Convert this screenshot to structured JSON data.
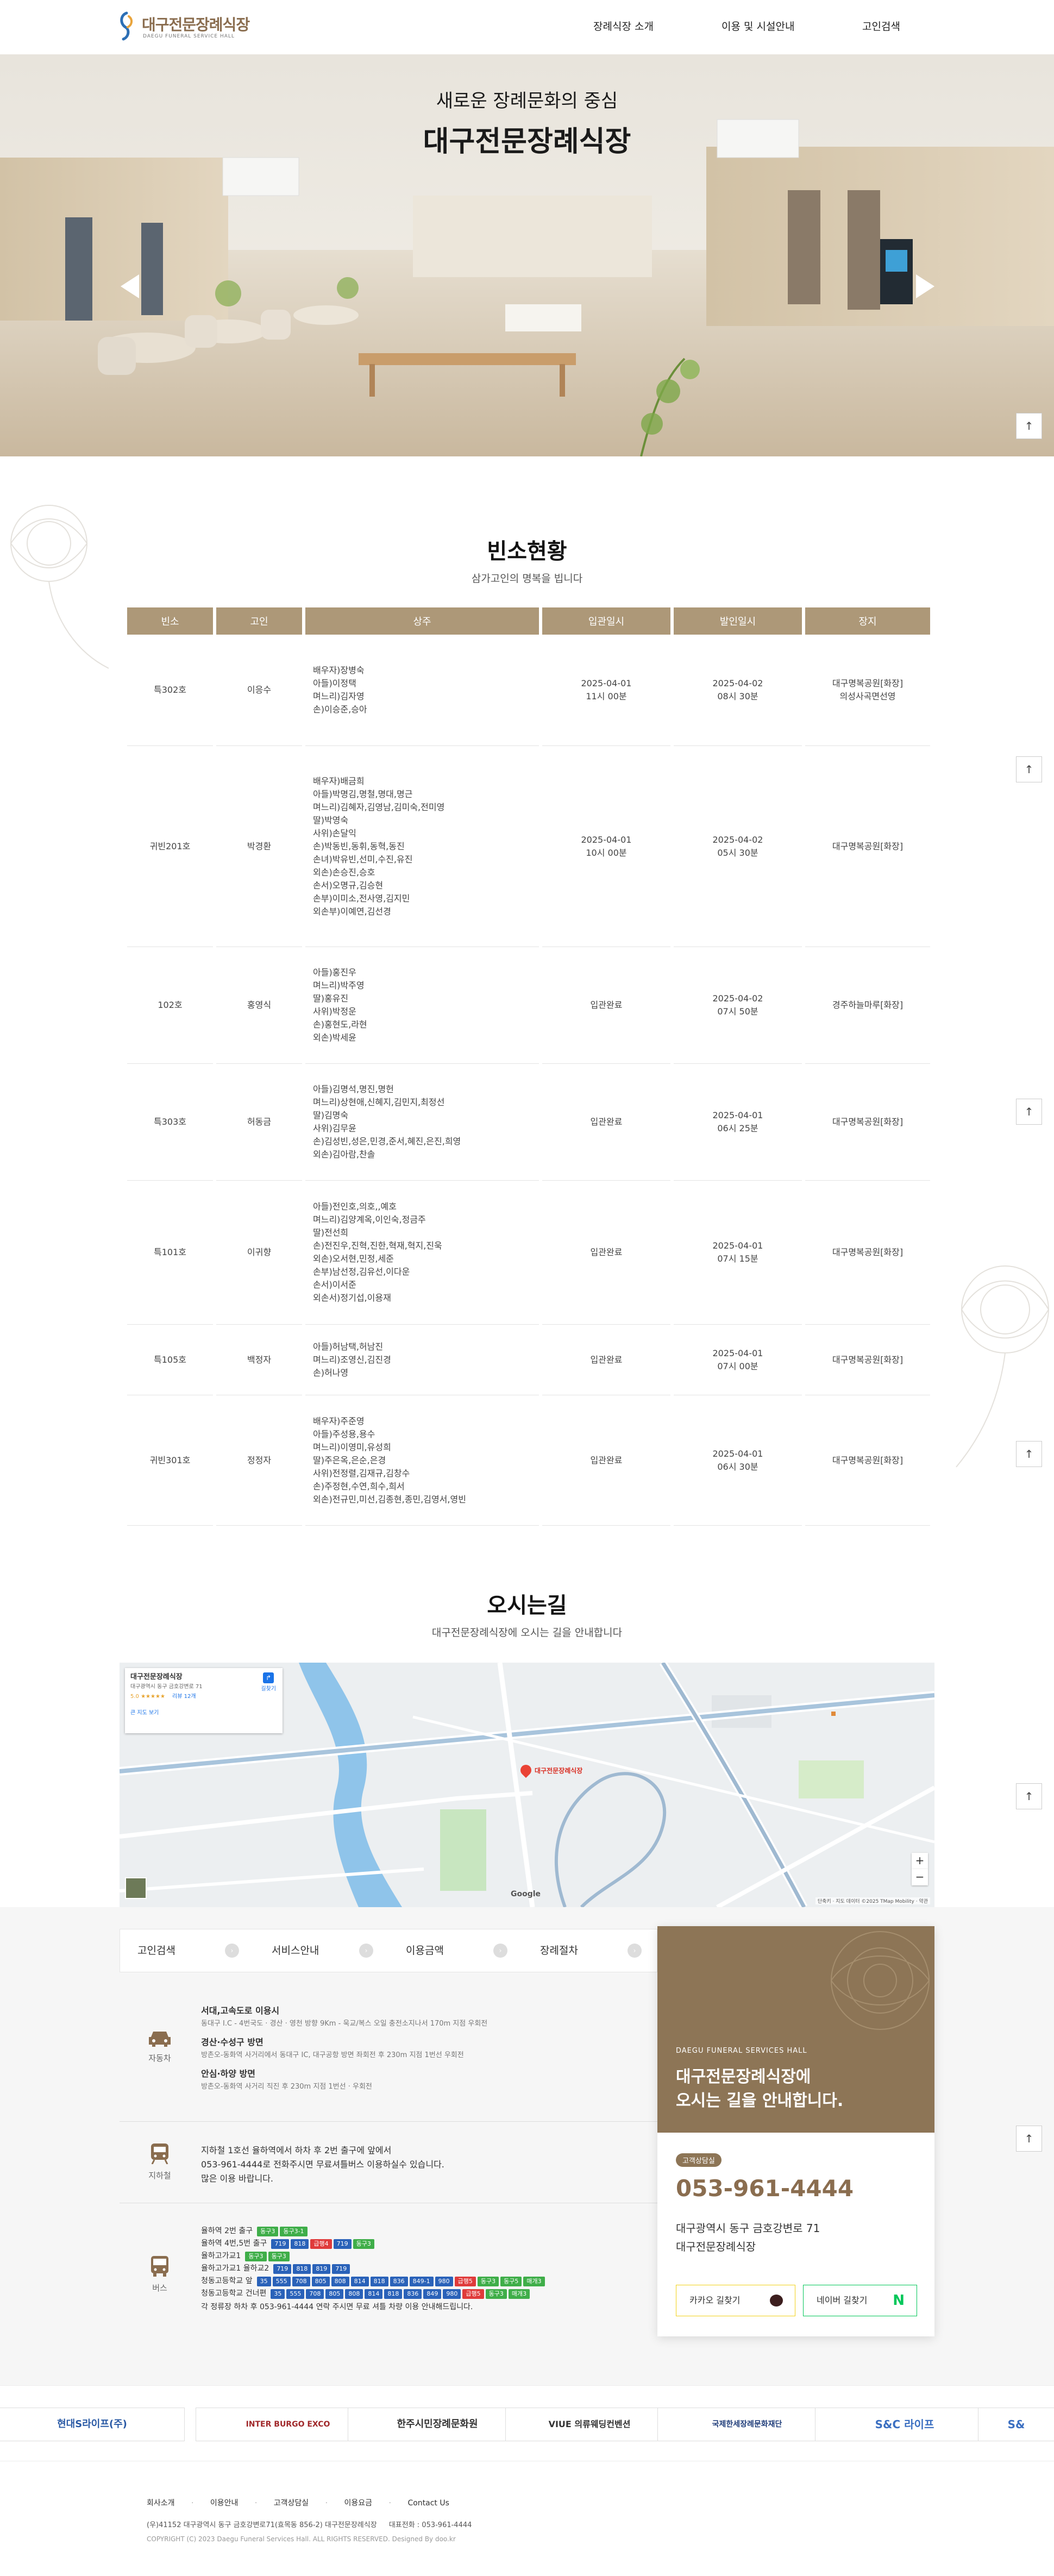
{
  "header": {
    "logo_title": "대구전문장례식장",
    "logo_sub": "DAEGU FUNERAL SERVICE HALL",
    "nav": [
      "장례식장 소개",
      "이용 및 시설안내",
      "고인검색"
    ]
  },
  "hero": {
    "subtitle": "새로운 장례문화의 중심",
    "title": "대구전문장례식장"
  },
  "side_buttons": [
    "↑",
    "↑",
    "↑",
    "↑",
    "↑",
    "↑"
  ],
  "mortuary": {
    "title": "빈소현황",
    "subtitle": "삼가고인의 명복을 빕니다",
    "headers": [
      "빈소",
      "고인",
      "상주",
      "입관일시",
      "발인일시",
      "장지"
    ],
    "rows": [
      {
        "room": "특302호",
        "name": "이응수",
        "mourners": "배우자)장병숙\n아들)이정택\n며느리)김자영\n손)이승준,승아",
        "entry": "2025-04-01\n11시 00분",
        "departure": "2025-04-02\n08시 30분",
        "burial": "대구명복공원[화장]\n의성사곡면선영"
      },
      {
        "room": "귀빈201호",
        "name": "박경환",
        "mourners": "배우자)배금희\n아들)박명김,명철,명대,명근\n며느리)김혜자,김영남,김미숙,전미영\n딸)박영숙\n사위)손달익\n손)박동빈,동휘,동혁,동진\n손녀)박유빈,선미,수진,유진\n외손)손승진,승호\n손서)오명규,김승현\n손부)이미소,전사영,김지민\n외손부)이예연,김선경",
        "entry": "2025-04-01\n10시 00분",
        "departure": "2025-04-02\n05시 30분",
        "burial": "대구명복공원[화장]"
      },
      {
        "room": "102호",
        "name": "홍영식",
        "mourners": "아들)홍진우\n며느리)박주영\n딸)홍유진\n사위)박정운\n손)홍현도,라현\n외손)박세윤",
        "entry": "입관완료",
        "departure": "2025-04-02\n07시 50분",
        "burial": "경주하늘마루[화장]"
      },
      {
        "room": "특303호",
        "name": "허동금",
        "mourners": "아들)김명석,명진,명헌\n며느리)상현애,신혜지,김민지,최정선\n딸)김명숙\n사위)김무윤\n손)김성빈,성은,민경,준서,혜진,은진,희영\n외손)김아람,찬솔",
        "entry": "입관완료",
        "departure": "2025-04-01\n06시 25분",
        "burial": "대구명복공원[화장]"
      },
      {
        "room": "특101호",
        "name": "이귀향",
        "mourners": "아들)전인호,의호,,예호\n며느리)김양계옥,이인숙,정금주\n딸)전선희\n손)전진우,진혁,진한,혁재,혁지,진욱\n외손)오서현,민정,세준\n손부)남선정,김유선,이다운\n손서)이서준\n외손서)정기섭,이용재",
        "entry": "입관완료",
        "departure": "2025-04-01\n07시 15분",
        "burial": "대구명복공원[화장]"
      },
      {
        "room": "특105호",
        "name": "백정자",
        "mourners": "아들)허남택,허남진\n며느리)조영신,김진경\n손)허나영",
        "entry": "입관완료",
        "departure": "2025-04-01\n07시 00분",
        "burial": "대구명복공원[화장]"
      },
      {
        "room": "귀빈301호",
        "name": "정정자",
        "mourners": "배우자)주준영\n아들)주성용,용수\n며느리)이영미,유성희\n딸)주은옥,은순,은경\n사위)전정렬,김재규,김창수\n손)주정현,수연,희수,희서\n외손)전규민,미선,김종현,종민,김영서,영빈",
        "entry": "입관완료",
        "departure": "2025-04-01\n06시 30분",
        "burial": "대구명복공원[화장]"
      }
    ]
  },
  "directions": {
    "title": "오시는길",
    "subtitle": "대구전문장례식장에 오시는 길을 안내합니다",
    "map_labels": {
      "place_name": "대구전문장례식장",
      "place_addr": "대구광역시 동구 금호강변로 71",
      "rating": "5.0 ★★★★★",
      "reviews": "리뷰 12개",
      "bigger_map": "큰 지도 보기",
      "route": "길찾기",
      "marker": "대구전문장례식장",
      "google": "Google",
      "copyright": "단축키 · 지도 데이터 ©2025 TMap Mobility · 약관"
    },
    "tabs": [
      "고인검색",
      "서비스안내",
      "이용금액",
      "장례절차"
    ],
    "car": {
      "label": "자동차",
      "lines": [
        {
          "head": "서대,고속도로 이용시",
          "body": "동대구 I.C - 4번국도 · 경산 · 영천 방향 9Km - 욱교/복스 오일 충전소지나서 170m 지점 우회전"
        },
        {
          "head": "경산·수성구 방면",
          "body": "방촌오-동화역 사거리에서 동대구 IC, 대구공항 방면 좌회전 후 230m 지점 1번선 우회전"
        },
        {
          "head": "안심·하양 방면",
          "body": "방촌오-동화역 사거리 직진 후 230m 지점 1번선 · 우회전"
        }
      ]
    },
    "subway": {
      "label": "지하철",
      "lines": [
        "지하철 1호선 율하역에서 하차 후 2번 출구에 앞에서",
        "053-961-4444로 전화주시면 무료셔틀버스 이용하실수 있습니다.",
        "많은 이용 바랍니다."
      ]
    },
    "bus": {
      "label": "버스",
      "lines": [
        {
          "text": "율하역 2번 출구",
          "chips": [
            {
              "t": "동구3",
              "c": "#3fae49"
            },
            {
              "t": "동구3-1",
              "c": "#3fae49"
            }
          ]
        },
        {
          "text": "율하역 4번,5번 출구",
          "chips": [
            {
              "t": "719",
              "c": "#2a62b9"
            },
            {
              "t": "818",
              "c": "#2a62b9"
            },
            {
              "t": "급행4",
              "c": "#e03b3b"
            },
            {
              "t": "719",
              "c": "#2a62b9"
            },
            {
              "t": "동구3",
              "c": "#3fae49"
            }
          ]
        },
        {
          "text": "율하고가교1",
          "chips": [
            {
              "t": "동구3",
              "c": "#3fae49"
            },
            {
              "t": "동구3",
              "c": "#3fae49"
            }
          ]
        },
        {
          "text": "율하고가교1 율하교2",
          "chips": [
            {
              "t": "719",
              "c": "#2a62b9"
            },
            {
              "t": "818",
              "c": "#2a62b9"
            },
            {
              "t": "819",
              "c": "#2a62b9"
            },
            {
              "t": "719",
              "c": "#2a62b9"
            }
          ]
        },
        {
          "text": "청동고등학교 앞",
          "chips": [
            {
              "t": "35",
              "c": "#2a62b9"
            },
            {
              "t": "555",
              "c": "#2a62b9"
            },
            {
              "t": "708",
              "c": "#2a62b9"
            },
            {
              "t": "805",
              "c": "#2a62b9"
            },
            {
              "t": "808",
              "c": "#2a62b9"
            },
            {
              "t": "814",
              "c": "#2a62b9"
            },
            {
              "t": "818",
              "c": "#2a62b9"
            },
            {
              "t": "836",
              "c": "#2a62b9"
            },
            {
              "t": "849-1",
              "c": "#2a62b9"
            },
            {
              "t": "980",
              "c": "#2a62b9"
            },
            {
              "t": "급행5",
              "c": "#e03b3b"
            },
            {
              "t": "동구3",
              "c": "#3fae49"
            },
            {
              "t": "동구5",
              "c": "#3fae49"
            },
            {
              "t": "매개3",
              "c": "#3fae49"
            }
          ]
        },
        {
          "text": "청동고등학교 건너편",
          "chips": [
            {
              "t": "35",
              "c": "#2a62b9"
            },
            {
              "t": "555",
              "c": "#2a62b9"
            },
            {
              "t": "708",
              "c": "#2a62b9"
            },
            {
              "t": "805",
              "c": "#2a62b9"
            },
            {
              "t": "808",
              "c": "#2a62b9"
            },
            {
              "t": "814",
              "c": "#2a62b9"
            },
            {
              "t": "818",
              "c": "#2a62b9"
            },
            {
              "t": "836",
              "c": "#2a62b9"
            },
            {
              "t": "849",
              "c": "#2a62b9"
            },
            {
              "t": "980",
              "c": "#2a62b9"
            },
            {
              "t": "급행5",
              "c": "#e03b3b"
            },
            {
              "t": "동구3",
              "c": "#3fae49"
            },
            {
              "t": "매개3",
              "c": "#3fae49"
            }
          ]
        }
      ],
      "note": "각 정류장 하차 후 053-961-4444 연락 주시면 무료 셔틀 차량 이용 안내해드립니다."
    },
    "card": {
      "en": "DAEGU FUNERAL SERVICES HALL",
      "headline1": "대구전문장례식장에",
      "headline2": "오시는 길을 안내합니다.",
      "badge": "고객상담실",
      "phone": "053-961-4444",
      "addr1": "대구광역시 동구 금호강변로 71",
      "addr2": "대구전문장례식장",
      "kakao": "카카오 길찾기",
      "naver": "네이버 길찾기"
    }
  },
  "partners": [
    "현대S라이프(주)",
    "INTER BURGO EXCO",
    "한주시민장례문화원",
    "VIUE 의류웨딩컨벤션",
    "국제한세장례문화재단",
    "S&C 라이프",
    "S&"
  ],
  "footer": {
    "links": [
      "회사소개",
      "이용안내",
      "고객상담실",
      "이용요금",
      "Contact Us"
    ],
    "address": "(우)41152 대구광역시 동구 금호강변로71(효목동 856-2) 대구전문장례식장",
    "phone_label": "대표전화 : 053-961-4444",
    "copyright": "COPYRIGHT (C) 2023 Daegu Funeral Services Hall. ALL RIGHTS RESERVED. Designed By doo.kr"
  },
  "colors": {
    "brand": "#8a6d4f",
    "table_head": "#ad9878",
    "card_top": "#8d7556"
  }
}
